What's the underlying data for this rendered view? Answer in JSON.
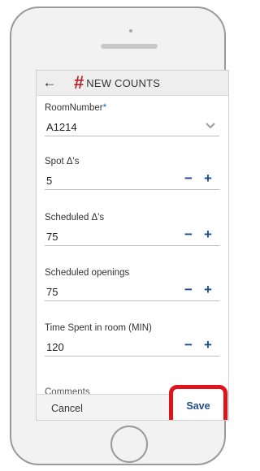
{
  "header": {
    "back_icon": "arrow-left-icon",
    "title_symbol": "#",
    "title": "NEW COUNTS"
  },
  "fields": [
    {
      "label": "RoomNumber",
      "required_marker": "*",
      "value": "A1214",
      "control": "dropdown"
    },
    {
      "label": "Spot Δ's",
      "value": "5",
      "control": "stepper"
    },
    {
      "label": "Scheduled Δ's",
      "value": "75",
      "control": "stepper"
    },
    {
      "label": "Scheduled openings",
      "value": "75",
      "control": "stepper"
    },
    {
      "label": "Time Spent in room (MIN)",
      "value": "120",
      "control": "stepper"
    }
  ],
  "partial_label": "Comments",
  "stepper": {
    "minus": "−",
    "plus": "+"
  },
  "footer": {
    "cancel_label": "Cancel",
    "save_label": "Save"
  },
  "colors": {
    "accent": "#1f4e8c",
    "hash": "#b5202a",
    "highlight": "#e0121b"
  }
}
